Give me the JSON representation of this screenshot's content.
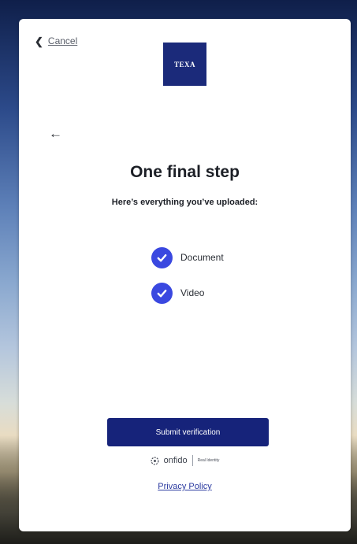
{
  "header": {
    "cancel_label": "Cancel",
    "logo_text": "TEXA"
  },
  "main": {
    "title": "One final step",
    "subtitle": "Here’s everything you’ve uploaded:",
    "uploads": [
      {
        "label": "Document",
        "status": "complete"
      },
      {
        "label": "Video",
        "status": "complete"
      }
    ]
  },
  "footer": {
    "submit_label": "Submit verification",
    "brand_name": "onfido",
    "brand_tagline": "Real Identity",
    "privacy_label": "Privacy Policy"
  },
  "colors": {
    "logo_bg": "#1b2a7a",
    "submit_bg": "#16237a",
    "check_bg": "#3a48e0",
    "link": "#2b3aa0"
  },
  "icons": {
    "cancel": "chevron-left-icon",
    "back": "arrow-left-icon",
    "check": "check-circle-icon",
    "brand": "onfido-logo-icon"
  }
}
